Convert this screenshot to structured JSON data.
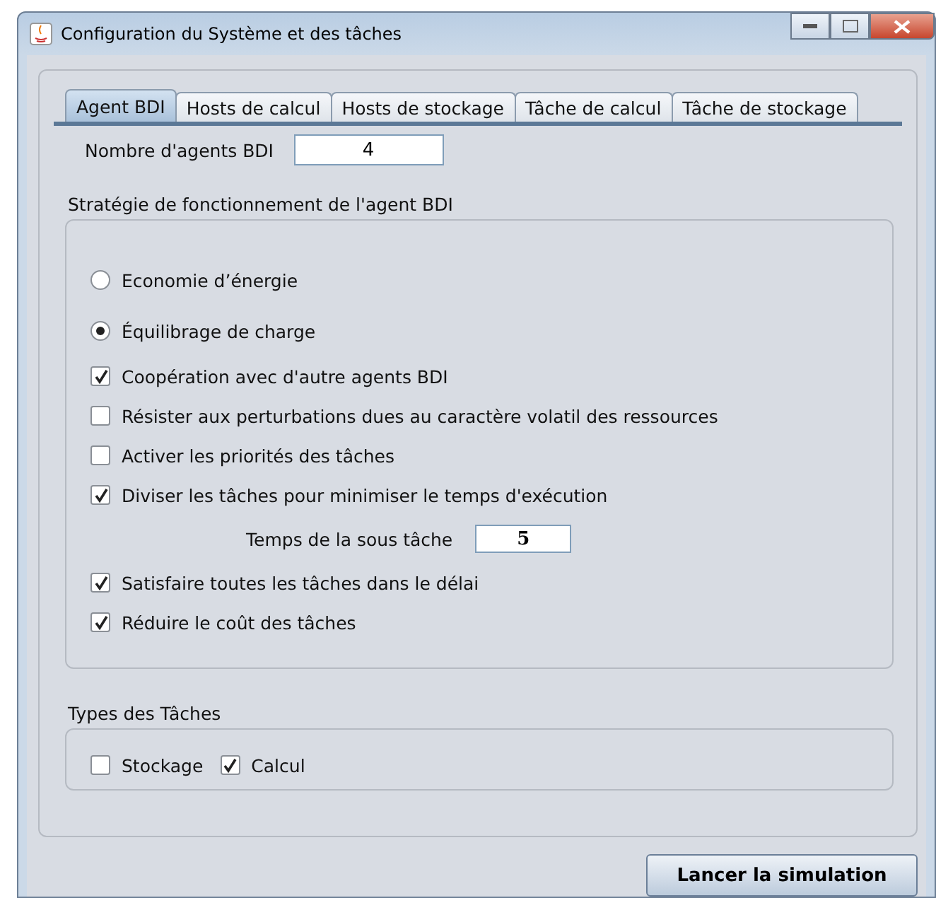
{
  "window": {
    "title": "Configuration du Système et des tâches"
  },
  "tabs": [
    {
      "label": "Agent BDI",
      "selected": true
    },
    {
      "label": "Hosts de calcul",
      "selected": false
    },
    {
      "label": "Hosts de stockage",
      "selected": false
    },
    {
      "label": "Tâche de calcul",
      "selected": false
    },
    {
      "label": "Tâche de stockage",
      "selected": false
    }
  ],
  "agent_count": {
    "label": "Nombre d'agents BDI",
    "value": "4"
  },
  "strategy": {
    "title": "Stratégie de fonctionnement de l'agent BDI",
    "items": [
      {
        "kind": "radio",
        "label": "Economie d’énergie",
        "selected": false
      },
      {
        "kind": "radio",
        "label": "Équilibrage de charge",
        "selected": true
      },
      {
        "kind": "checkbox",
        "label": "Coopération avec d'autre agents BDI",
        "checked": true
      },
      {
        "kind": "checkbox",
        "label": "Résister aux perturbations dues au caractère volatil des ressources",
        "checked": false
      },
      {
        "kind": "checkbox",
        "label": "Activer les priorités des tâches",
        "checked": false
      },
      {
        "kind": "checkbox",
        "label": "Diviser les tâches pour minimiser le temps d'exécution",
        "checked": true
      },
      {
        "kind": "field",
        "label": "Temps de la sous tâche",
        "value": "5"
      },
      {
        "kind": "checkbox",
        "label": "Satisfaire toutes les tâches dans le délai",
        "checked": true
      },
      {
        "kind": "checkbox",
        "label": "Réduire le coût des tâches",
        "checked": true
      }
    ]
  },
  "task_types": {
    "title": "Types des Tâches",
    "items": [
      {
        "label": "Stockage",
        "checked": false
      },
      {
        "label": "Calcul",
        "checked": true
      }
    ]
  },
  "buttons": [
    "Lancer la simulation"
  ]
}
